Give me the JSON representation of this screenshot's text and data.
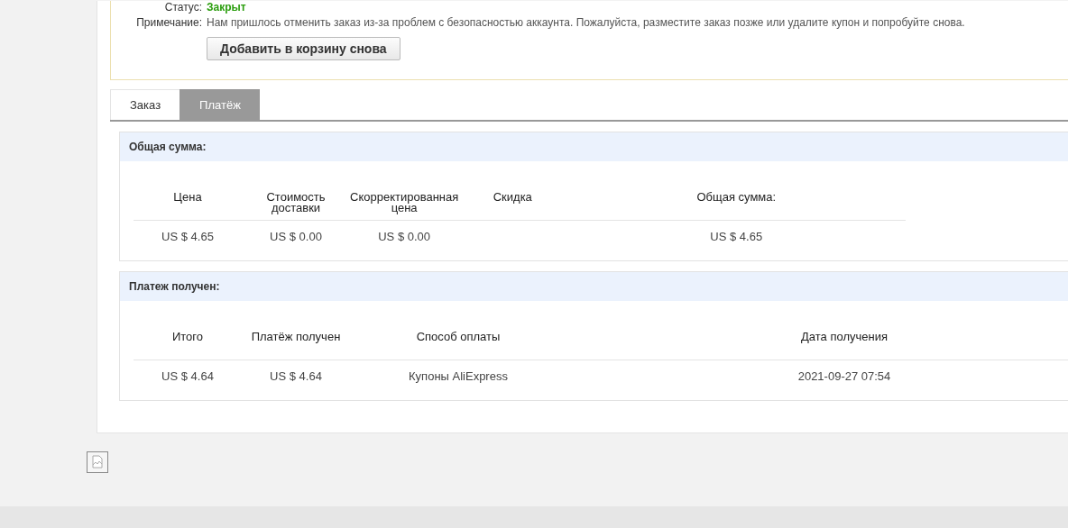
{
  "order_info": {
    "fields": [
      {
        "label": "Статус:",
        "value": "Закрыт",
        "kind": "status"
      },
      {
        "label": "Примечание:",
        "value": "Нам пришлось отменить заказ из-за проблем с безопасностью аккаунта. Пожалуйста, разместите заказ позже или удалите купон и попробуйте снова.",
        "kind": "note"
      }
    ],
    "button": "Добавить в корзину снова"
  },
  "tabs": [
    {
      "label": "Заказ",
      "selected": false
    },
    {
      "label": "Платёж",
      "selected": true
    }
  ],
  "sections": [
    {
      "title": "Общая сумма:",
      "columns": [
        "Цена",
        "Стоимость доставки",
        "Скорректированная цена",
        "Скидка",
        "Общая сумма:"
      ],
      "rows": [
        [
          "US $ 4.65",
          "US $ 0.00",
          "US $ 0.00",
          "",
          "US $ 4.65"
        ]
      ]
    },
    {
      "title": "Платеж получен:",
      "columns": [
        "Итого",
        "Платёж получен",
        "Способ оплаты",
        "Дата получения"
      ],
      "rows": [
        [
          "US $ 4.64",
          "US $ 4.64",
          "Купоны AliExpress",
          "2021-09-27 07:54"
        ]
      ]
    }
  ]
}
